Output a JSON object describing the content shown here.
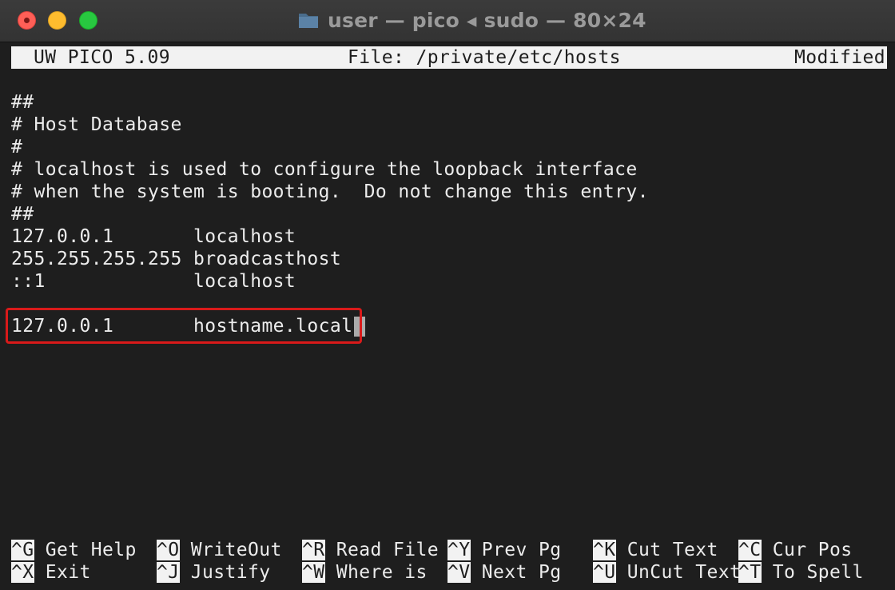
{
  "window": {
    "title": "user — pico ◂ sudo — 80×24"
  },
  "editor": {
    "header": {
      "app": "UW PICO 5.09",
      "file": "File: /private/etc/hosts",
      "status": "Modified"
    },
    "lines": [
      "",
      "##",
      "# Host Database",
      "#",
      "# localhost is used to configure the loopback interface",
      "# when the system is booting.  Do not change this entry.",
      "##",
      "127.0.0.1       localhost",
      "255.255.255.255 broadcasthost",
      "::1             localhost",
      "",
      "127.0.0.1       hostname.local"
    ],
    "shortcuts_row1": [
      {
        "key": "^G",
        "label": " Get Help"
      },
      {
        "key": "^O",
        "label": " WriteOut"
      },
      {
        "key": "^R",
        "label": " Read File"
      },
      {
        "key": "^Y",
        "label": " Prev Pg"
      },
      {
        "key": "^K",
        "label": " Cut Text"
      },
      {
        "key": "^C",
        "label": " Cur Pos"
      }
    ],
    "shortcuts_row2": [
      {
        "key": "^X",
        "label": " Exit"
      },
      {
        "key": "^J",
        "label": " Justify"
      },
      {
        "key": "^W",
        "label": " Where is"
      },
      {
        "key": "^V",
        "label": " Next Pg"
      },
      {
        "key": "^U",
        "label": " UnCut Text"
      },
      {
        "key": "^T",
        "label": " To Spell"
      }
    ]
  },
  "colors": {
    "background": "#1e1e1e",
    "text": "#ececec",
    "inverse_bg": "#f2f2f2",
    "highlight_border": "#d91a1a",
    "cursor": "#aaaaaa"
  }
}
